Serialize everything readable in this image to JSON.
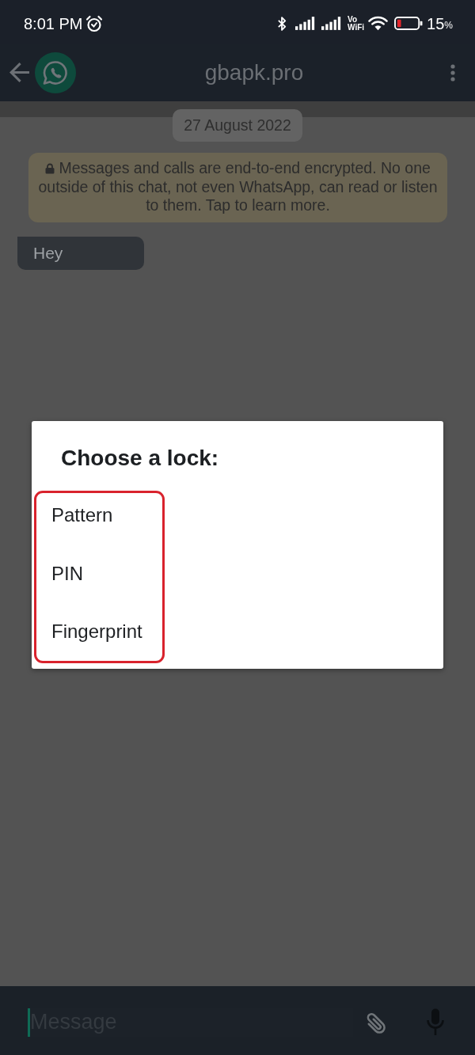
{
  "status_bar": {
    "time": "8:01 PM",
    "vowifi": {
      "top": "Vo",
      "bottom": "WiFi"
    },
    "battery": "15",
    "battery_unit": "%"
  },
  "app_bar": {
    "title": "gbapk.pro"
  },
  "chat": {
    "date_chip": "27 August 2022",
    "encryption_notice": "Messages and calls are end-to-end encrypted. No one outside of this chat, not even WhatsApp, can read or listen to them. Tap to learn more.",
    "messages": [
      {
        "kind": "incoming",
        "text": "Hey"
      }
    ]
  },
  "dialog": {
    "title": "Choose a lock:",
    "highlighted": true,
    "options": [
      {
        "label": "Pattern",
        "selected": false
      },
      {
        "label": "PIN",
        "selected": false
      },
      {
        "label": "Fingerprint",
        "selected": false
      }
    ]
  },
  "composer": {
    "placeholder": "Message"
  }
}
